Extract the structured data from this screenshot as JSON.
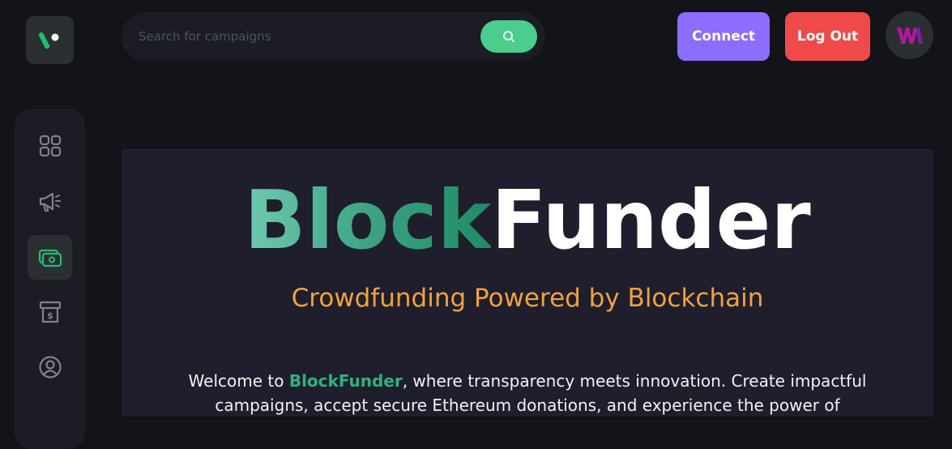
{
  "header": {
    "search": {
      "placeholder": "Search for campaigns",
      "value": ""
    },
    "connect_label": "Connect",
    "logout_label": "Log Out"
  },
  "sidebar": {
    "items": [
      {
        "icon": "dashboard-grid-icon",
        "active": false
      },
      {
        "icon": "megaphone-icon",
        "active": false
      },
      {
        "icon": "wallet-icon",
        "active": true
      },
      {
        "icon": "withdraw-icon",
        "active": false
      },
      {
        "icon": "profile-icon",
        "active": false
      }
    ]
  },
  "hero": {
    "brand_part1": "Block",
    "brand_part2": "Funder",
    "tagline": "Crowdfunding Powered by Blockchain",
    "welcome_prefix": "Welcome to ",
    "welcome_brand": "BlockFunder",
    "welcome_suffix": ", where transparency meets innovation. Create impactful campaigns, accept secure Ethereum donations, and experience the power of"
  },
  "colors": {
    "accent_green": "#4acd8d",
    "connect_purple": "#8c6dfd",
    "logout_red": "#ef4949",
    "tagline_orange": "#f0a23b",
    "background": "#13131a",
    "panel": "#1c1c24"
  }
}
